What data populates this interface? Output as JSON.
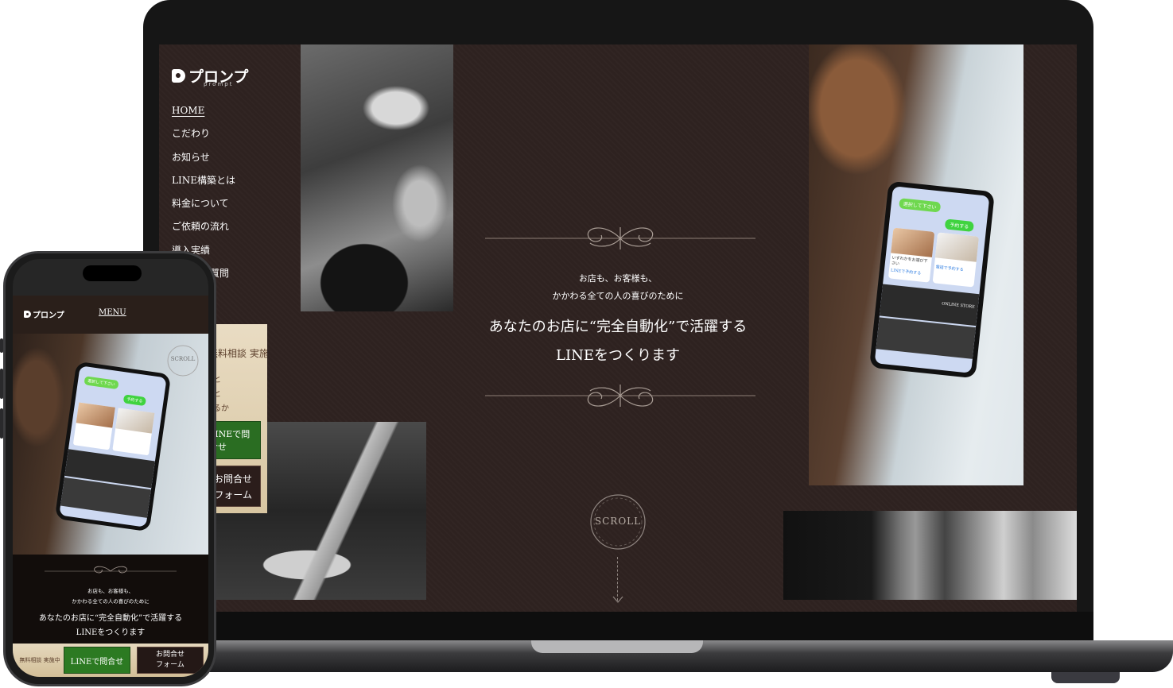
{
  "desktop": {
    "logo": {
      "text": "プロンプ",
      "sub": "prompt"
    },
    "nav": [
      {
        "label": "HOME"
      },
      {
        "label": "こだわり"
      },
      {
        "label": "お知らせ"
      },
      {
        "label": "LINE構築とは"
      },
      {
        "label": "料金について"
      },
      {
        "label": "ご依頼の流れ"
      },
      {
        "label": "導入実績"
      },
      {
        "label": "よくある質問"
      }
    ],
    "campaign": {
      "title": "無料相談 実施中",
      "lines": [
        "と",
        "と",
        "るか"
      ],
      "line_button": "LINEで問合せ",
      "form_button": [
        "お問合せ",
        "フォーム"
      ]
    },
    "hero": {
      "sub_line1": "お店も、お客様も、",
      "sub_line2": "かかわる全ての人の喜びのために",
      "main_line1": "あなたのお店に“完全自動化”で活躍する",
      "main_line2": "LINEをつくります"
    },
    "scroll_label": "SCROLL",
    "mockup_chat": {
      "bubble1": "選択して下さい",
      "bubble2": "予約する",
      "card1": "いずれかをお選び下さい",
      "card1_link": "LINEで予約する",
      "card2": "電話で予約する",
      "shop": "ONLINE STORE"
    }
  },
  "mobile": {
    "logo": {
      "text": "プロンプ"
    },
    "menu_label": "MENU",
    "scroll_label": "SCROLL",
    "hero": {
      "sub_line1": "お店も、お客様も、",
      "sub_line2": "かかわる全ての人の喜びのために",
      "main_line1": "あなたのお店に“完全自動化”で活躍する",
      "main_line2": "LINEをつくります"
    },
    "bottom_bar": {
      "label": "無料相談 実施中",
      "line_button": "LINEで問合せ",
      "form_button": [
        "お問合せ",
        "フォーム"
      ]
    }
  },
  "colors": {
    "screen_bg": "#2e2220",
    "line_green": "#2c7a22",
    "paper": "#e5d8bd",
    "dark_button": "#241816"
  }
}
